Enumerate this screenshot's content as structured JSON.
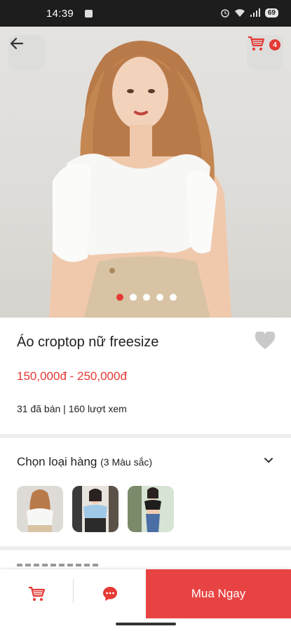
{
  "status_bar": {
    "time": "14:39",
    "battery": "69"
  },
  "hero": {
    "cart_count": "4",
    "slide_count": 5,
    "active_slide": 0
  },
  "product": {
    "name": "Áo croptop nữ freesize",
    "price_range": "150,000đ - 250,000đ",
    "stats": "31 đã bán | 160 lượt xem"
  },
  "variants": {
    "title": "Chọn loại hàng",
    "count_label": "(3 Màu sắc)",
    "thumbnails": [
      "white-croptop",
      "blue-croptop",
      "black-croptop"
    ]
  },
  "bottom_bar": {
    "buy_label": "Mua Ngay"
  },
  "colors": {
    "accent": "#e53935",
    "buy_button": "#e84343"
  },
  "icons": [
    "arrow-left-icon",
    "cart-icon",
    "heart-icon",
    "chevron-down-icon",
    "chat-icon",
    "add-to-cart-icon"
  ]
}
